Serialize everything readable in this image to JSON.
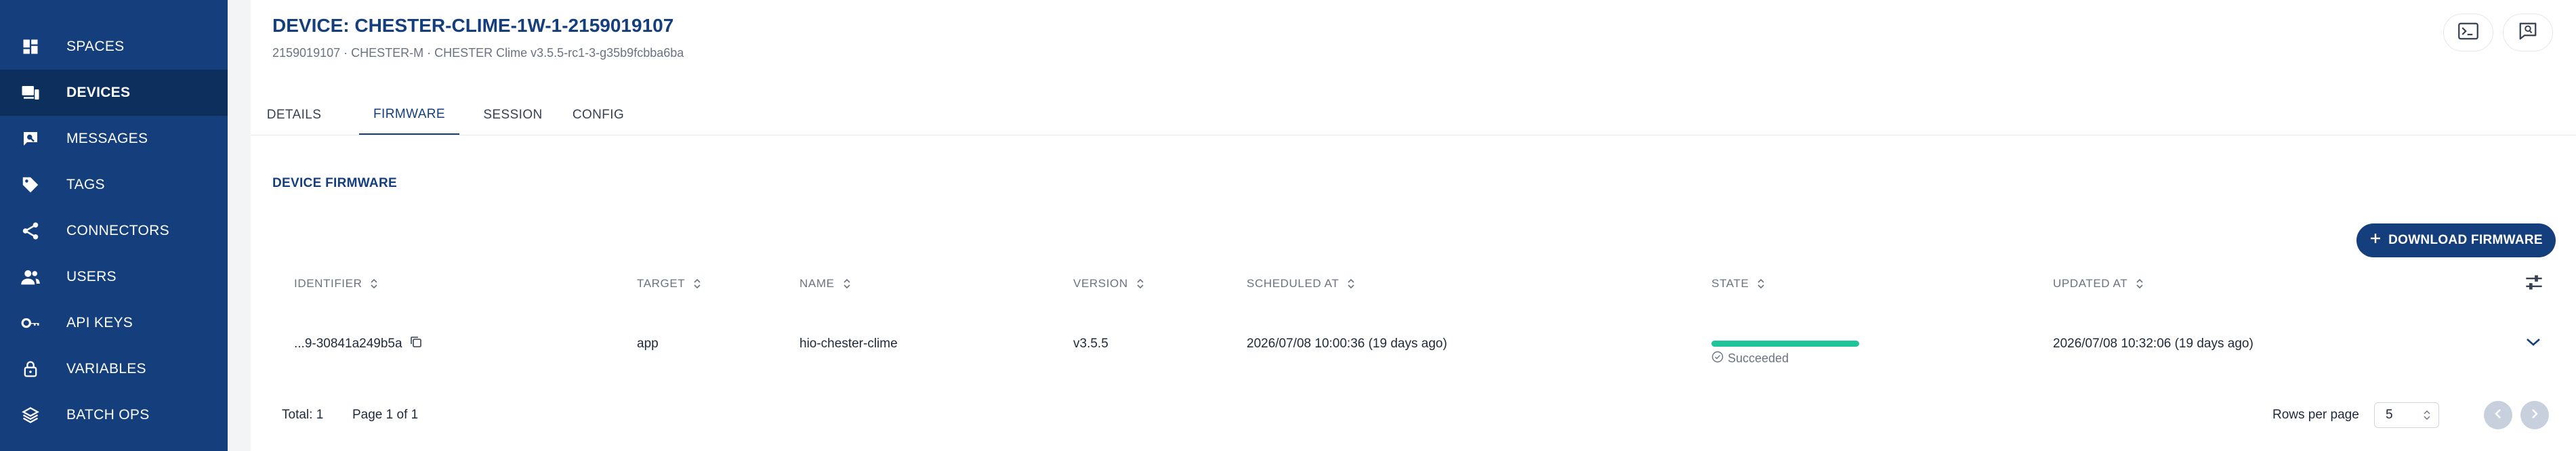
{
  "sidebar": {
    "items": [
      {
        "label": "SPACES",
        "icon": "grid-icon",
        "active": false
      },
      {
        "label": "DEVICES",
        "icon": "devices-icon",
        "active": true
      },
      {
        "label": "MESSAGES",
        "icon": "messages-icon",
        "active": false
      },
      {
        "label": "TAGS",
        "icon": "tags-icon",
        "active": false
      },
      {
        "label": "CONNECTORS",
        "icon": "share-icon",
        "active": false
      },
      {
        "label": "USERS",
        "icon": "users-icon",
        "active": false
      },
      {
        "label": "API KEYS",
        "icon": "key-icon",
        "active": false
      },
      {
        "label": "VARIABLES",
        "icon": "lock-icon",
        "active": false
      },
      {
        "label": "BATCH OPS",
        "icon": "layers-icon",
        "active": false
      }
    ]
  },
  "header": {
    "title": "DEVICE: CHESTER-CLIME-1W-1-2159019107",
    "subtitle": "2159019107 · CHESTER-M · CHESTER Clime v3.5.5-rc1-3-g35b9fcbba6ba"
  },
  "tabs": [
    {
      "label": "DETAILS",
      "active": false
    },
    {
      "label": "FIRMWARE",
      "active": true
    },
    {
      "label": "SESSION",
      "active": false
    },
    {
      "label": "CONFIG",
      "active": false
    }
  ],
  "section": {
    "title": "DEVICE FIRMWARE",
    "download_label": "DOWNLOAD FIRMWARE"
  },
  "table": {
    "columns": [
      "IDENTIFIER",
      "TARGET",
      "NAME",
      "VERSION",
      "SCHEDULED AT",
      "STATE",
      "UPDATED AT"
    ],
    "rows": [
      {
        "identifier": "...9-30841a249b5a",
        "target": "app",
        "name": "hio-chester-clime",
        "version": "v3.5.5",
        "scheduled_at": "2026/07/08 10:00:36 (19 days ago)",
        "state": "Succeeded",
        "state_progress": 1.0,
        "updated_at": "2026/07/08 10:32:06 (19 days ago)"
      }
    ]
  },
  "footer": {
    "total": "Total: 1",
    "page": "Page 1 of 1",
    "rows_per_page_label": "Rows per page",
    "rows_per_page_value": "5"
  },
  "colors": {
    "brand": "#143f7c",
    "success": "#21c39a"
  }
}
